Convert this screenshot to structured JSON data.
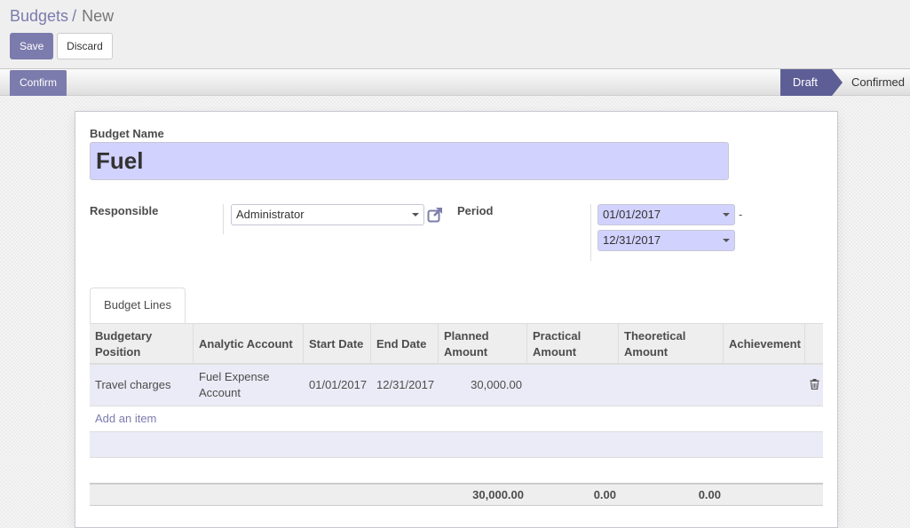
{
  "breadcrumb": {
    "parent": "Budgets",
    "separator": "/",
    "current": "New"
  },
  "toolbar": {
    "save_label": "Save",
    "discard_label": "Discard"
  },
  "statusbar": {
    "confirm_label": "Confirm",
    "states": [
      "Draft",
      "Confirmed"
    ],
    "active_state": "Draft"
  },
  "form": {
    "budget_name_label": "Budget Name",
    "budget_name_value": "Fuel",
    "responsible_label": "Responsible",
    "responsible_value": "Administrator",
    "period_label": "Period",
    "period_start": "01/01/2017",
    "period_separator": "-",
    "period_end": "12/31/2017"
  },
  "tabs": [
    {
      "label": "Budget Lines",
      "active": true
    }
  ],
  "grid": {
    "columns": [
      {
        "label": "Budgetary Position"
      },
      {
        "label": "Analytic Account"
      },
      {
        "label": "Start Date"
      },
      {
        "label": "End Date"
      },
      {
        "label": "Planned Amount"
      },
      {
        "label": "Practical Amount"
      },
      {
        "label": "Theoretical Amount"
      },
      {
        "label": "Achievement"
      }
    ],
    "rows": [
      {
        "budgetary_position": "Travel charges",
        "analytic_account": "Fuel Expense Account",
        "start_date": "01/01/2017",
        "end_date": "12/31/2017",
        "planned_amount": "30,000.00",
        "practical_amount": "",
        "theoretical_amount": "",
        "achievement": ""
      }
    ],
    "add_item_label": "Add an item",
    "totals": {
      "planned": "30,000.00",
      "practical": "0.00",
      "theoretical": "0.00"
    }
  },
  "icons": {
    "external_link": "external-link-icon",
    "trash": "trash-icon",
    "dropdown": "caret-down-icon"
  },
  "colors": {
    "primary": "#7c7bad",
    "status_active": "#5e5e96",
    "input_highlight": "#d2d2ff",
    "row_highlight": "#ebebf7"
  }
}
